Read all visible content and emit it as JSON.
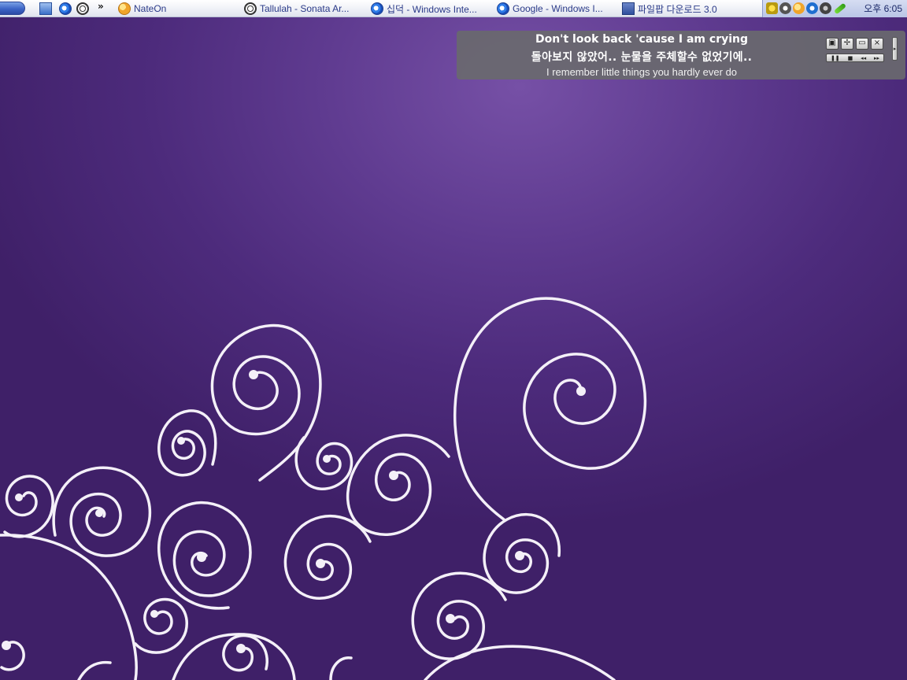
{
  "taskbar": {
    "overflow_chevron": "»",
    "tasks": [
      {
        "label": "NateOn",
        "icon": "nateon-icon"
      },
      {
        "label": "Tallulah - Sonata Ar...",
        "icon": "media-player-icon"
      },
      {
        "label": "십덕 - Windows Inte...",
        "icon": "internet-explorer-icon"
      },
      {
        "label": "Google - Windows I...",
        "icon": "internet-explorer-icon"
      },
      {
        "label": "파일팝 다운로드 3.0",
        "icon": "download-app-icon"
      }
    ],
    "clock": "오후 6:05"
  },
  "lyrics": {
    "line1": "Don't look back 'cause I am crying",
    "line2": "돌아보지 않았어.. 눈물을 주체할수 없었기에..",
    "line3": "I remember little things you hardly ever do",
    "controls": {
      "mode": "▣",
      "move": "✢",
      "minimize": "▭",
      "close": "×",
      "pause": "❚❚",
      "stop": "■",
      "prev": "◂◂",
      "next": "▸▸",
      "grip": "▸"
    }
  },
  "colors": {
    "wallpaper": "#5a3a8c",
    "swirl": "#ffffff",
    "taskbar_text": "#2a3a88",
    "panel": "#69696e"
  }
}
